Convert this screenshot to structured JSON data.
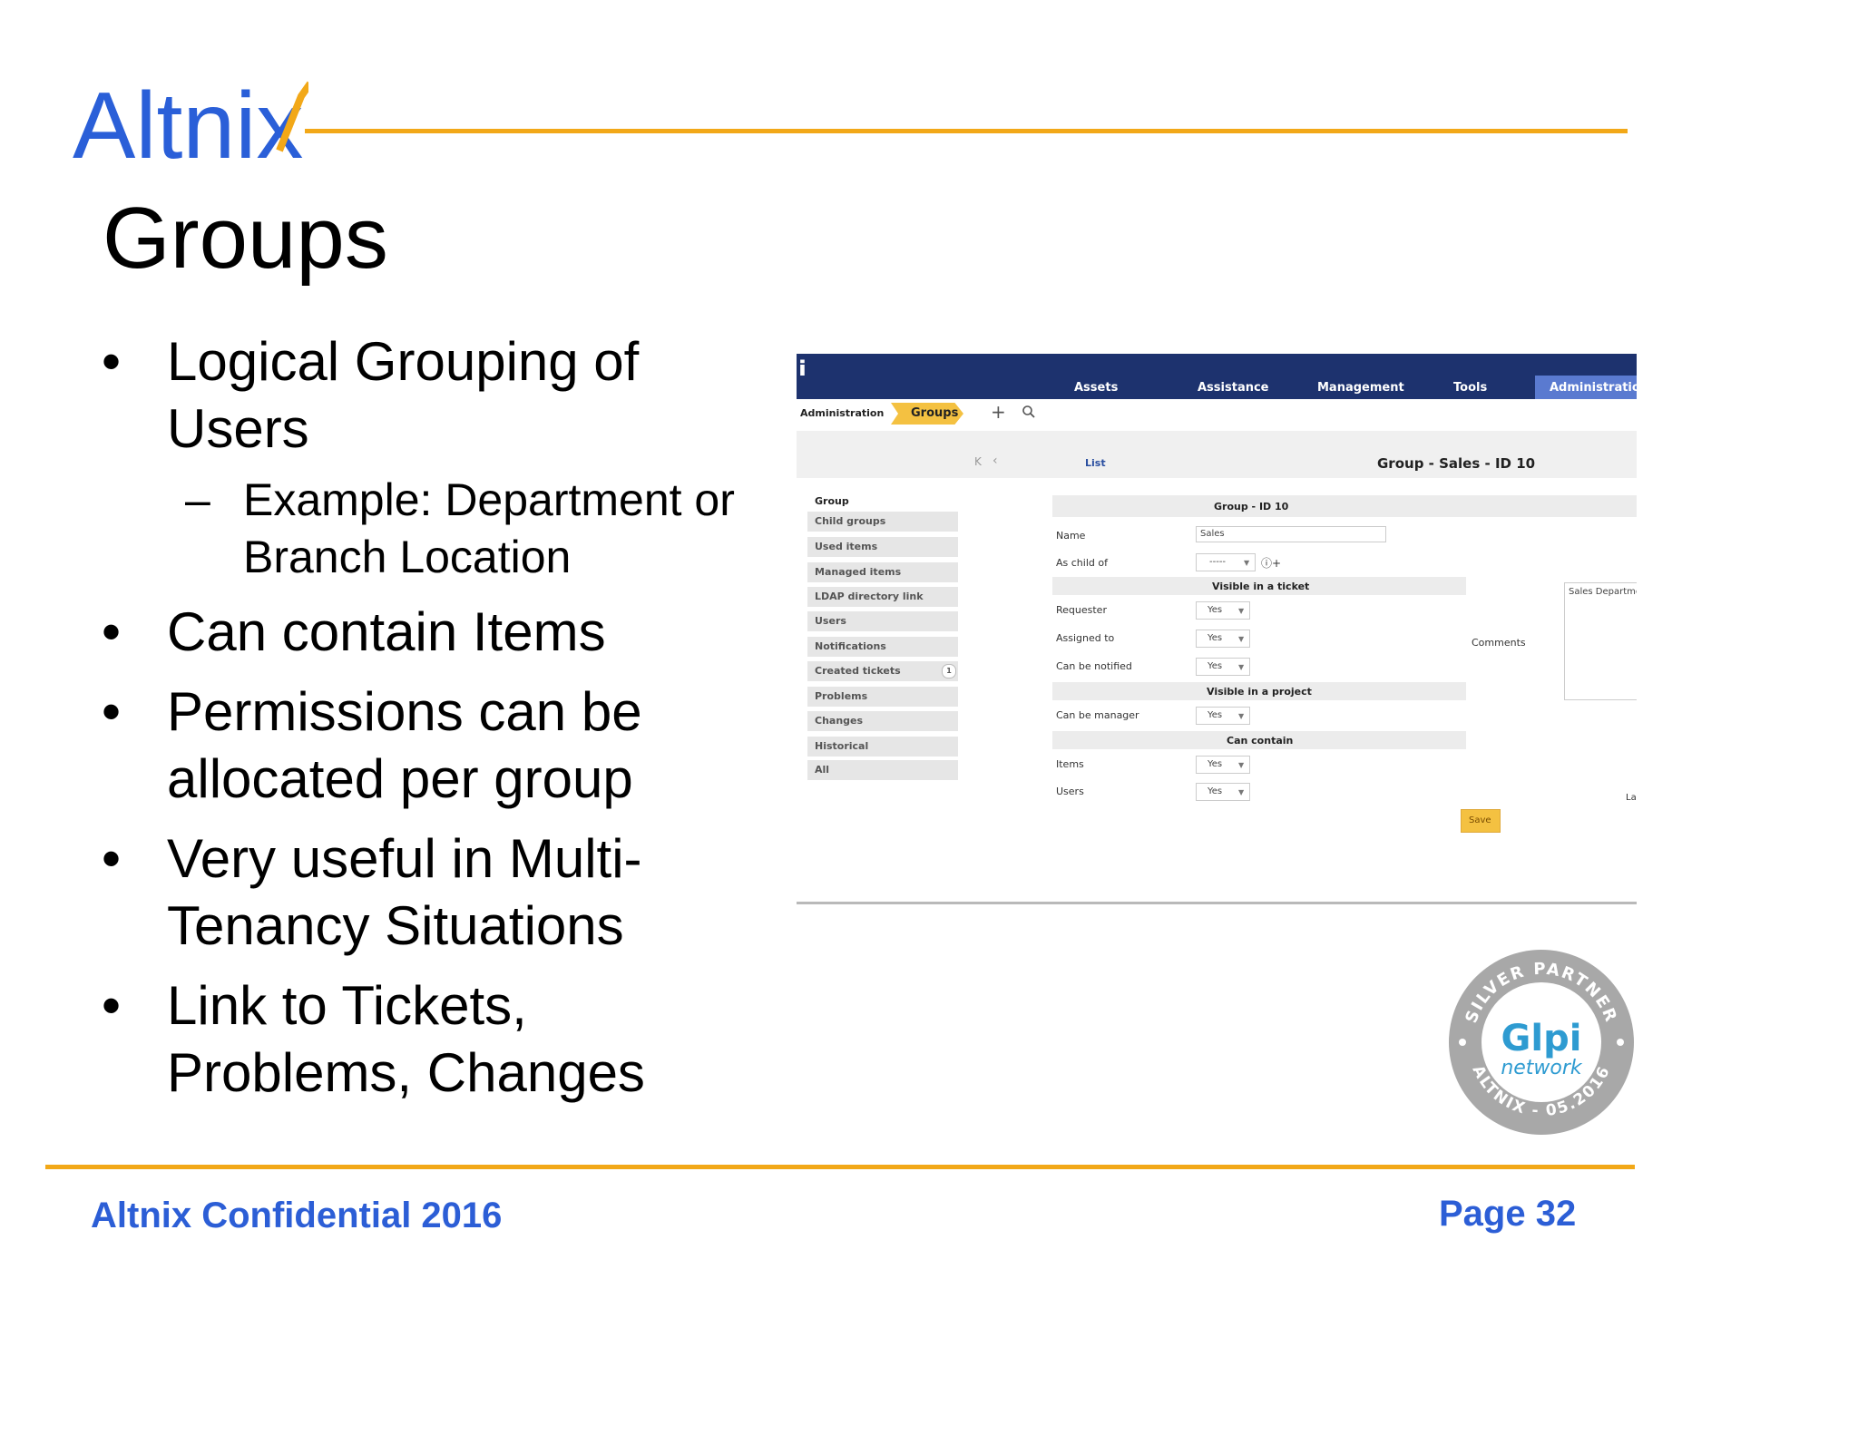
{
  "logo": {
    "text": "Altnix"
  },
  "slide": {
    "title": "Groups",
    "bullets": [
      {
        "text": "Logical Grouping of Users",
        "line1": "Logical Grouping of",
        "line2": "Users"
      },
      {
        "text": "Can contain Items"
      },
      {
        "text": "Permissions can be allocated per group",
        "line1": "Permissions can be",
        "line2": "allocated per group"
      },
      {
        "text": "Very useful in Multi-Tenancy Situations",
        "line1": "Very useful in Multi-",
        "line2": "Tenancy Situations"
      },
      {
        "text": "Link to Tickets, Problems, Changes",
        "line1": "Link to Tickets,",
        "line2": "Problems, Changes"
      }
    ],
    "sub_bullet": {
      "line1": "Example: Department or",
      "line2": "Branch Location"
    }
  },
  "screenshot": {
    "nav": [
      "Assets",
      "Assistance",
      "Management",
      "Tools",
      "Administratio"
    ],
    "breadcrumb": {
      "first": "Administration",
      "current": "Groups"
    },
    "list_link": "List",
    "record_title": "Group - Sales - ID 10",
    "sidebar": {
      "header": "Group",
      "items": [
        "Child groups",
        "Used items",
        "Managed items",
        "LDAP directory link",
        "Users",
        "Notifications",
        "Created tickets",
        "Problems",
        "Changes",
        "Historical",
        "All"
      ],
      "tickets_count": "1"
    },
    "form": {
      "header": "Group - ID 10",
      "name_label": "Name",
      "name_value": "Sales",
      "child_of_label": "As child of",
      "child_of_value": "-----",
      "section_ticket": "Visible in a ticket",
      "requester_label": "Requester",
      "assigned_label": "Assigned to",
      "notified_label": "Can be notified",
      "section_project": "Visible in a project",
      "manager_label": "Can be manager",
      "section_contain": "Can contain",
      "items_label": "Items",
      "users_label": "Users",
      "yes": "Yes",
      "comments_label": "Comments",
      "comments_value": "Sales Departme",
      "save_label": "Save",
      "cut_label": "La"
    }
  },
  "badge": {
    "top_text": "SILVER PARTNER",
    "brand": "Glpi",
    "sub": "network",
    "bottom_text": "ALTNIX - 05.2016"
  },
  "footer": {
    "left": "Altnix Confidential 2016",
    "right": "Page 32"
  },
  "colors": {
    "accent": "#f2a818",
    "brand_blue": "#2c5ed6",
    "glpi_nav": "#1d326e"
  }
}
